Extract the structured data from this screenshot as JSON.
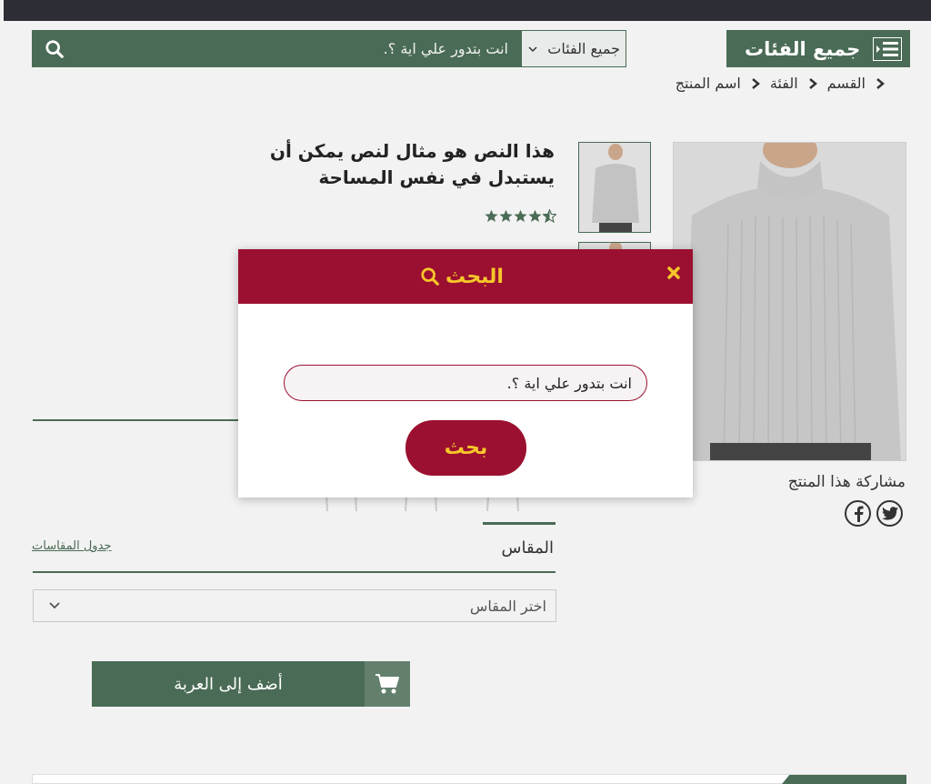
{
  "header": {
    "search_placeholder": "انت بتدور علي اية ؟.",
    "category_select": "جميع الفئات",
    "all_categories": "جميع الفئات"
  },
  "breadcrumb": [
    "القسم",
    "الفئة",
    "اسم المنتج"
  ],
  "product": {
    "title": "هذا النص هو مثال لنص يمكن أن يستبدل في نفس المساحة",
    "rating": 4.5,
    "size_label": "المقاس",
    "size_chart_link": "جدول المقاسات",
    "size_select_placeholder": "اختر المقاس",
    "add_to_cart": "أضف إلى العربة",
    "share_label": "مشاركة هذا المنتج"
  },
  "modal": {
    "title": "البحث",
    "input_placeholder": "انت بتدور علي اية ؟.",
    "submit_label": "بحث"
  },
  "colors": {
    "primary_green": "#4a6b55",
    "modal_red": "#9b1030",
    "modal_accent": "#f6c72a",
    "topbar": "#2d2d35"
  }
}
